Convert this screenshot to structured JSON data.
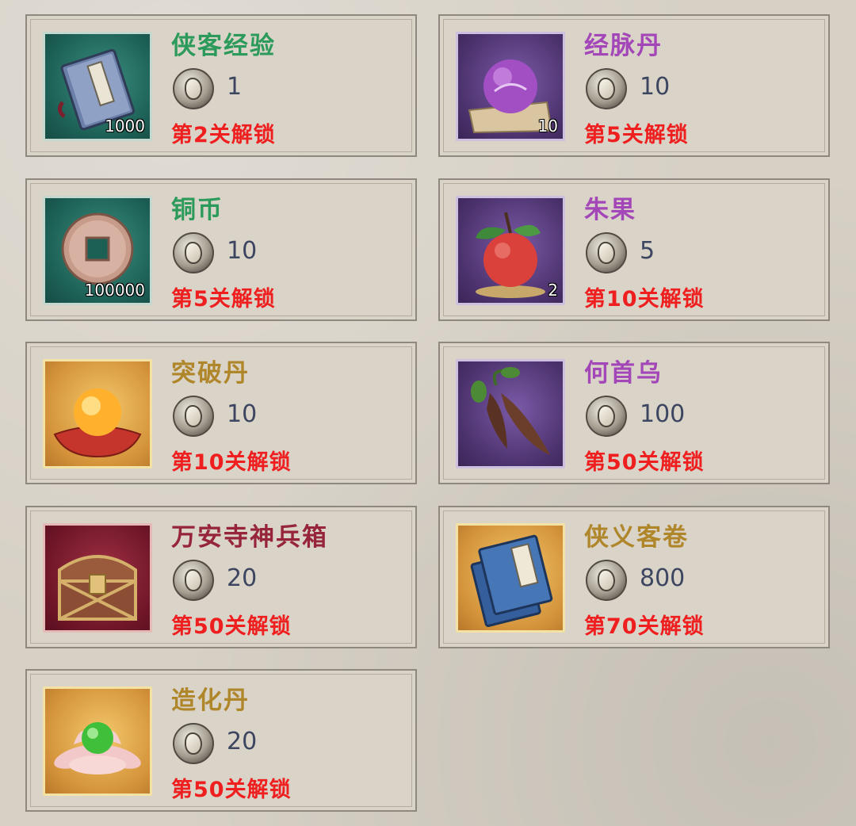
{
  "items": [
    {
      "name": "侠客经验",
      "name_color": "green",
      "frame": "green",
      "icon": "book-icon",
      "quantity": "1000",
      "cost": "1",
      "unlock": "第2关解锁"
    },
    {
      "name": "经脉丹",
      "name_color": "purple",
      "frame": "purple",
      "icon": "orb-icon",
      "quantity": "10",
      "cost": "10",
      "unlock": "第5关解锁"
    },
    {
      "name": "铜币",
      "name_color": "green",
      "frame": "green",
      "icon": "coin-icon",
      "quantity": "100000",
      "cost": "10",
      "unlock": "第5关解锁"
    },
    {
      "name": "朱果",
      "name_color": "purple",
      "frame": "purple",
      "icon": "fruit-icon",
      "quantity": "2",
      "cost": "5",
      "unlock": "第10关解锁"
    },
    {
      "name": "突破丹",
      "name_color": "gold",
      "frame": "gold",
      "icon": "pearl-icon",
      "quantity": "",
      "cost": "10",
      "unlock": "第10关解锁"
    },
    {
      "name": "何首乌",
      "name_color": "purple",
      "frame": "purple",
      "icon": "root-icon",
      "quantity": "",
      "cost": "100",
      "unlock": "第50关解锁"
    },
    {
      "name": "万安寺神兵箱",
      "name_color": "darkred",
      "frame": "red",
      "icon": "chest-icon",
      "quantity": "",
      "cost": "20",
      "unlock": "第50关解锁"
    },
    {
      "name": "侠义客卷",
      "name_color": "gold",
      "frame": "gold",
      "icon": "scroll-book-icon",
      "quantity": "",
      "cost": "800",
      "unlock": "第70关解锁"
    },
    {
      "name": "造化丹",
      "name_color": "gold",
      "frame": "gold",
      "icon": "lotus-pill-icon",
      "quantity": "",
      "cost": "20",
      "unlock": "第50关解锁"
    }
  ],
  "currency_icon": "silver-coin-icon"
}
